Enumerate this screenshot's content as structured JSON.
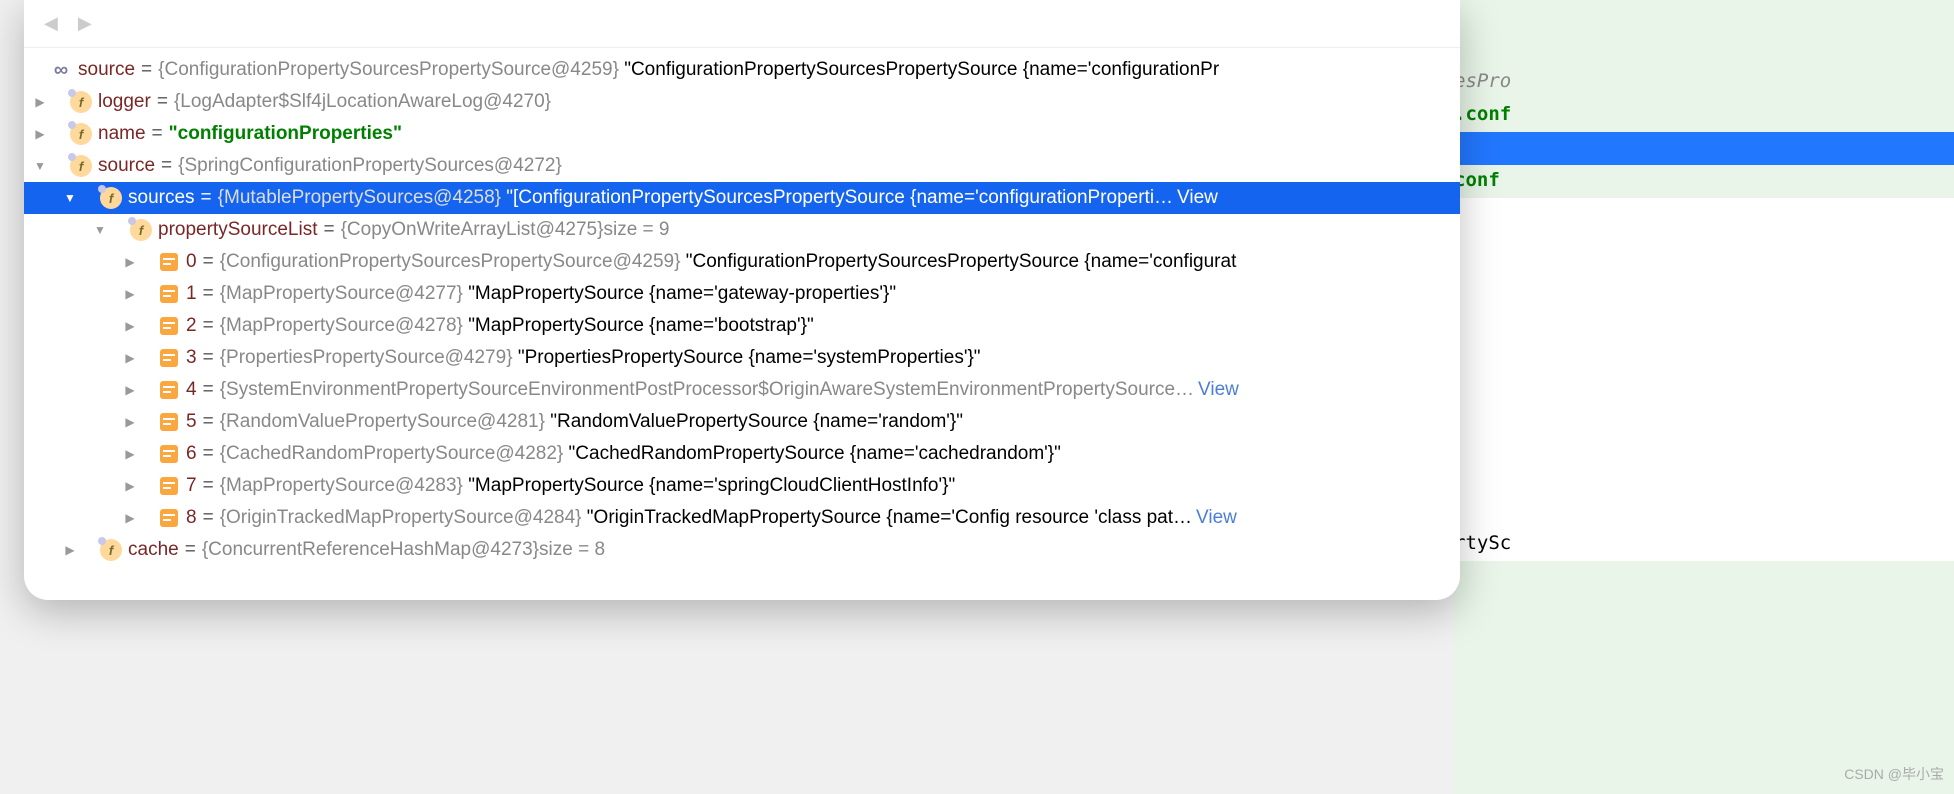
{
  "bg_code": {
    "line1": "esPro",
    "conf": ".conf",
    "conf2": "conf",
    "rty": "rtySc"
  },
  "root": {
    "source_top": {
      "name": "source",
      "ref": "{ConfigurationPropertySourcesPropertySource@4259}",
      "val": "\"ConfigurationPropertySourcesPropertySource {name='configurationPr"
    },
    "logger": {
      "name": "logger",
      "ref": "{LogAdapter$Slf4jLocationAwareLog@4270}"
    },
    "name_field": {
      "name": "name",
      "val": "\"configurationProperties\""
    },
    "source": {
      "name": "source",
      "ref": "{SpringConfigurationPropertySources@4272}",
      "sources": {
        "name": "sources",
        "ref": "{MutablePropertySources@4258}",
        "val": "\"[ConfigurationPropertySourcesPropertySource {name='configurationProperti…",
        "view": "View",
        "propertySourceList": {
          "name": "propertySourceList",
          "ref": "{CopyOnWriteArrayList@4275}",
          "size": " size = 9",
          "items": [
            {
              "idx": "0",
              "ref": "{ConfigurationPropertySourcesPropertySource@4259}",
              "val": "\"ConfigurationPropertySourcesPropertySource {name='configurat"
            },
            {
              "idx": "1",
              "ref": "{MapPropertySource@4277}",
              "val": "\"MapPropertySource {name='gateway-properties'}\""
            },
            {
              "idx": "2",
              "ref": "{MapPropertySource@4278}",
              "val": "\"MapPropertySource {name='bootstrap'}\""
            },
            {
              "idx": "3",
              "ref": "{PropertiesPropertySource@4279}",
              "val": "\"PropertiesPropertySource {name='systemProperties'}\""
            },
            {
              "idx": "4",
              "ref": "{SystemEnvironmentPropertySourceEnvironmentPostProcessor$OriginAwareSystemEnvironmentPropertySource…",
              "val": "",
              "view": "View"
            },
            {
              "idx": "5",
              "ref": "{RandomValuePropertySource@4281}",
              "val": "\"RandomValuePropertySource {name='random'}\""
            },
            {
              "idx": "6",
              "ref": "{CachedRandomPropertySource@4282}",
              "val": "\"CachedRandomPropertySource {name='cachedrandom'}\""
            },
            {
              "idx": "7",
              "ref": "{MapPropertySource@4283}",
              "val": "\"MapPropertySource {name='springCloudClientHostInfo'}\""
            },
            {
              "idx": "8",
              "ref": "{OriginTrackedMapPropertySource@4284}",
              "val": "\"OriginTrackedMapPropertySource {name='Config resource 'class pat…",
              "view": "View"
            }
          ]
        }
      },
      "cache": {
        "name": "cache",
        "ref": "{ConcurrentReferenceHashMap@4273}",
        "size": " size = 8"
      }
    }
  },
  "watermark": "CSDN @毕小宝"
}
